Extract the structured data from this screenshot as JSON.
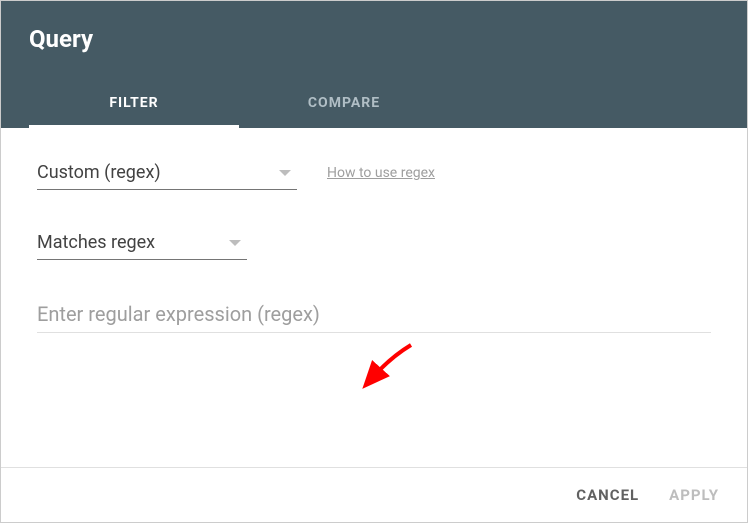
{
  "header": {
    "title": "Query"
  },
  "tabs": {
    "filter": "FILTER",
    "compare": "COMPARE"
  },
  "dropdowns": {
    "type": "Custom (regex)",
    "match": "Matches regex"
  },
  "links": {
    "help": "How to use regex"
  },
  "input": {
    "placeholder": "Enter regular expression (regex)"
  },
  "buttons": {
    "cancel": "CANCEL",
    "apply": "APPLY"
  }
}
